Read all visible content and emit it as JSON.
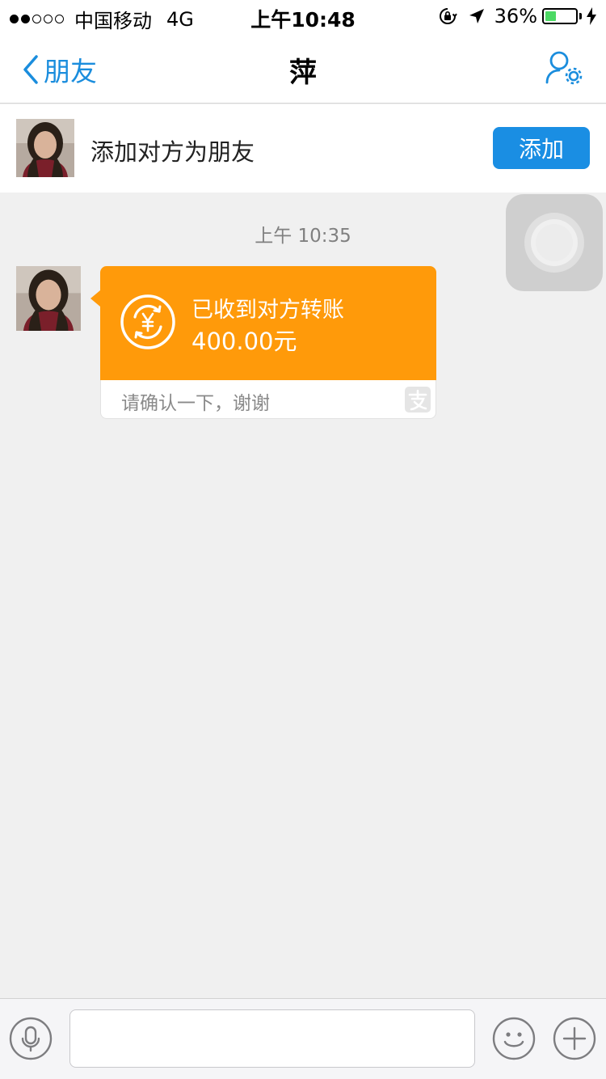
{
  "status_bar": {
    "carrier": "中国移动",
    "network": "4G",
    "time": "上午10:48",
    "battery_percent": "36%",
    "battery_level": 0.36,
    "signal_bars_filled": 2,
    "signal_bars_total": 5,
    "icons": [
      "orientation-lock-icon",
      "location-arrow-icon",
      "charging-bolt-icon"
    ]
  },
  "nav": {
    "back_label": "朋友",
    "title": "萍",
    "settings_icon": "user-settings-icon",
    "accent_color": "#1a8ddd"
  },
  "add_friend": {
    "prompt": "添加对方为朋友",
    "button_label": "添加",
    "button_color": "#1a8ee3"
  },
  "chat": {
    "timestamp": "上午 10:35",
    "messages": [
      {
        "type": "transfer",
        "title": "已收到对方转账",
        "amount": "400.00元",
        "note": "请确认一下，谢谢",
        "card_color": "#ff9a0a",
        "icon": "transfer-yuan-icon",
        "source_icon": "alipay-icon"
      }
    ]
  },
  "input_bar": {
    "placeholder": "",
    "value": "",
    "icons": [
      "microphone-icon",
      "emoji-icon",
      "plus-icon"
    ]
  }
}
